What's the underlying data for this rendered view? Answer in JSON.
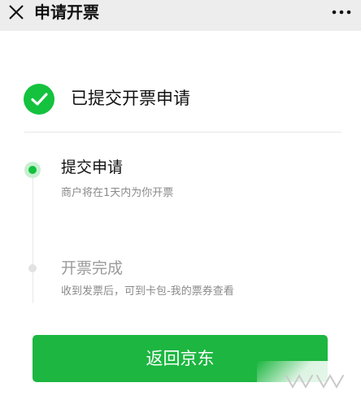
{
  "header": {
    "title": "申请开票",
    "close_icon": "close-icon",
    "more_icon": "more-icon"
  },
  "status": {
    "icon": "check-circle-icon",
    "text": "已提交开票申请",
    "color": "#14c23e"
  },
  "steps": [
    {
      "title": "提交申请",
      "description": "商户将在1天内为你开票",
      "state": "active"
    },
    {
      "title": "开票完成",
      "description": "收到发票后，可到卡包-我的票券查看",
      "state": "pending"
    }
  ],
  "action": {
    "return_label": "返回京东",
    "color": "#1cb640"
  },
  "watermark": {
    "icon": "watermark-logo"
  }
}
